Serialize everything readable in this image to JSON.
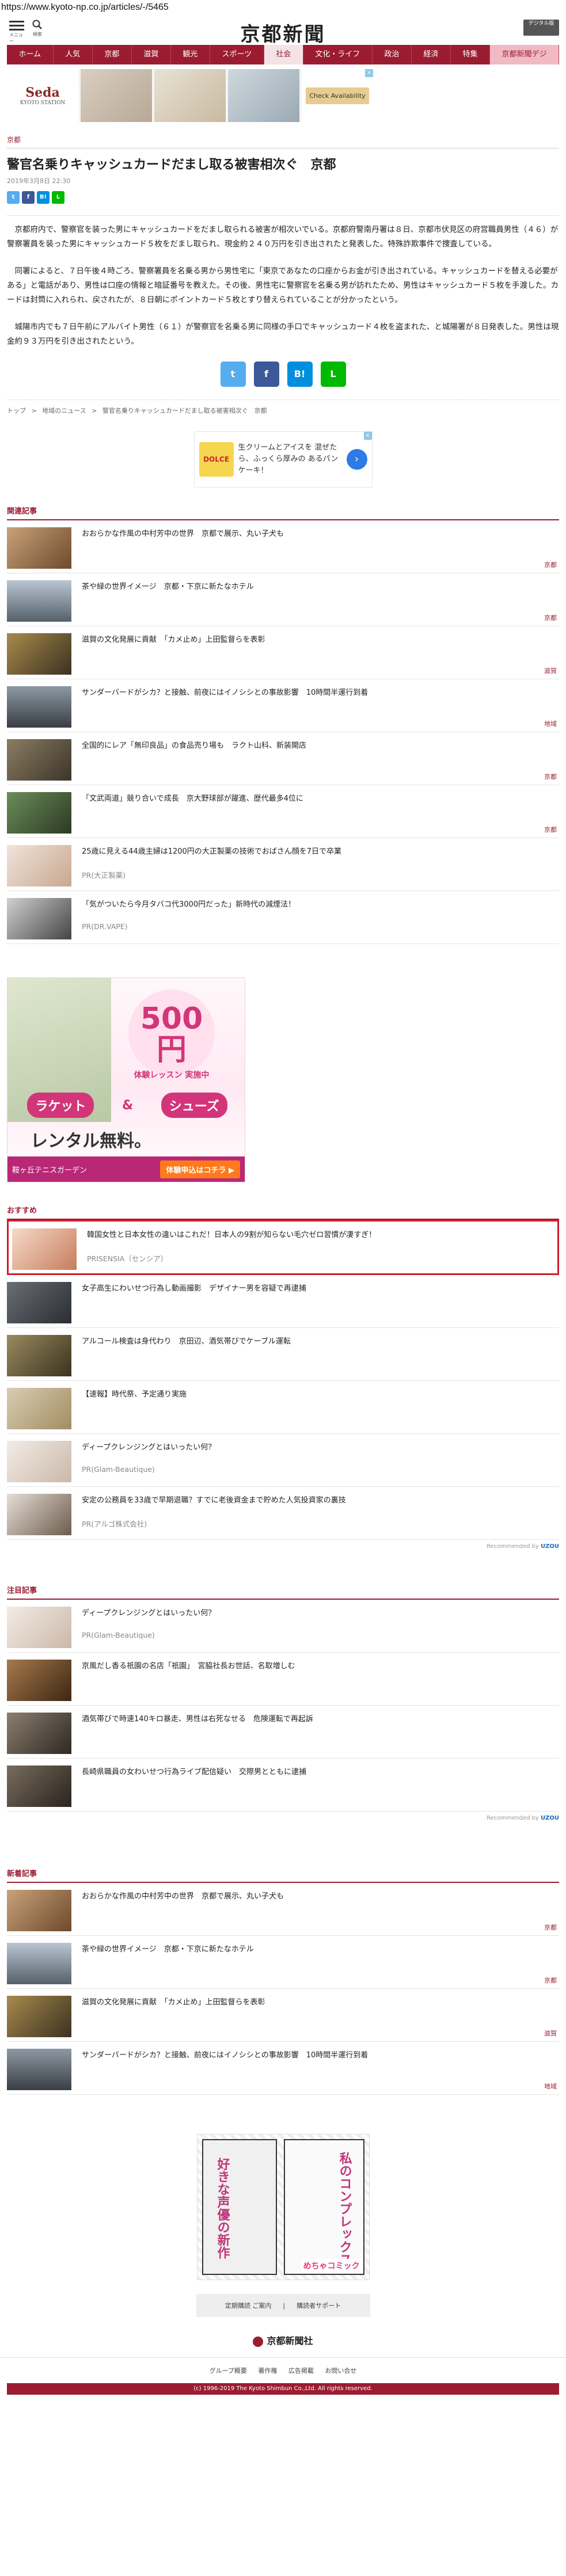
{
  "url": "https://www.kyoto-np.co.jp/articles/-/5465",
  "header": {
    "menu_label": "メニュー",
    "search_label": "検索",
    "logo": "京都新聞",
    "digital_label": "デジタル版"
  },
  "nav": [
    {
      "label": "ホーム"
    },
    {
      "label": "人気"
    },
    {
      "label": "京都"
    },
    {
      "label": "滋賀"
    },
    {
      "label": "観光"
    },
    {
      "label": "スポーツ"
    },
    {
      "label": "社会"
    },
    {
      "label": "文化・ライフ"
    },
    {
      "label": "政治"
    },
    {
      "label": "経済"
    },
    {
      "label": "特集"
    },
    {
      "label": "京都新聞デジ"
    }
  ],
  "top_ad": {
    "brand": "Seda",
    "brand_sub": "KYOTO STATION",
    "cta": "Check Availability",
    "close": "×"
  },
  "article": {
    "category": "京都",
    "title": "警官名乗りキャッシュカードだまし取る被害相次ぐ　京都",
    "date": "2019年3月8日 22:30",
    "paragraphs": [
      "京都府内で、警察官を装った男にキャッシュカードをだまし取られる被害が相次いでいる。京都府警南丹署は８日、京都市伏見区の府営職員男性（４６）が警察署員を装った男にキャッシュカード５枚をだまし取られ、現金約２４０万円を引き出されたと発表した。特殊詐欺事件で捜査している。",
      "同署によると、７日午後４時ごろ、警察署員を名乗る男から男性宅に「東京であなたの口座からお金が引き出されている。キャッシュカードを替える必要がある」と電話があり、男性は口座の情報と暗証番号を教えた。その後、男性宅に警察官を名乗る男が訪れたため、男性はキャッシュカード５枚を手渡した。カードは封筒に入れられ、戻されたが、８日朝にポイントカード５枚とすり替えられていることが分かったという。",
      "城陽市内でも７日午前にアルバイト男性（６１）が警察官を名乗る男に同様の手口でキャッシュカード４枚を盗まれた、と城陽署が８日発表した。男性は現金約９３万円を引き出されたという。"
    ],
    "share": {
      "tw": "t",
      "fb": "f",
      "hb": "B!",
      "ln": "L"
    }
  },
  "breadcrumb": [
    "トップ",
    ">",
    "地域のニュース",
    ">",
    "警官名乗りキャッシュカードだまし取る被害相次ぐ　京都"
  ],
  "mid_ad": {
    "brand": "DOLCE",
    "text": "生クリームとアイスを 混ぜたら、ふっくら厚みの あるパンケーキ！",
    "arrow": "›"
  },
  "related": {
    "heading": "関連記事",
    "items": [
      {
        "title": "おおらかな作風の中村芳中の世界　京都で展示、丸い子犬も",
        "cat": "京都"
      },
      {
        "title": "茶や緑の世界イメージ　京都・下京に新たなホテル",
        "cat": "京都"
      },
      {
        "title": "滋賀の文化発展に貢献　「カメ止め」上田監督らを表彰",
        "cat": "滋賀"
      },
      {
        "title": "サンダーバードがシカ？と接触、前夜にはイノシシとの事故影響　10時間半運行到着",
        "cat": "地域"
      },
      {
        "title": "全国的にレア「無印良品」の食品売り場も　ラクト山科、新装開店",
        "cat": "京都"
      },
      {
        "title": "「文武両道」競り合いで成長　京大野球部が躍進、歴代最多4位に",
        "cat": "京都"
      },
      {
        "title": "25歳に見える44歳主婦は1200円の大正製薬の技術でおばさん顔を7日で卒業",
        "pr": "PR(大正製薬)"
      },
      {
        "title": "「気がついたら今月タバコ代3000円だった」新時代の減煙法！",
        "pr": "PR(DR.VAPE)"
      }
    ]
  },
  "big_ad": {
    "num": "500円",
    "sub": "体験レッスン 実施中",
    "racket": "ラケット",
    "and": "&",
    "shoes": "シューズ",
    "rental": "レンタル無料。",
    "venue": "鞍ヶ丘テニスガーデン",
    "cta": "体験申込はコチラ ▶"
  },
  "recommend": {
    "heading": "おすすめ",
    "items": [
      {
        "title": "韓国女性と日本女性の違いはこれだ！日本人の9割が知らない毛穴ゼロ習慣が凄すぎ！",
        "pr": "PRISENSIA（センシア）"
      },
      {
        "title": "女子高生にわいせつ行為し動画撮影　デザイナー男を容疑で再逮捕"
      },
      {
        "title": "アルコール検査は身代わり　京田辺、酒気帯びでケーブル運転"
      },
      {
        "title": "【速報】時代祭、予定通り実施"
      },
      {
        "title": "ディープクレンジングとはいったい何？",
        "pr": "PR(Glam-Beautique)"
      },
      {
        "title": "安定の公務員を33歳で早期退職？すでに老後資金まで貯めた人気投資家の裏技",
        "pr": "PR(アルゴ株式会社)"
      }
    ],
    "by": "Recommended by",
    "by_brand": "UZOU"
  },
  "notable": {
    "heading": "注目記事",
    "items": [
      {
        "title": "ディープクレンジングとはいったい何？",
        "pr": "PR(Glam-Beautique)"
      },
      {
        "title": "京風だし香る祇園の名店「祇園」　宮脇社長お世話、名取増しむ"
      },
      {
        "title": "酒気帯びで時速140キロ暴走、男性は右死なせる　危険運転で再起訴"
      },
      {
        "title": "長崎県職員の女わいせつ行為ライブ配信疑い　交際男とともに逮捕"
      }
    ],
    "by": "Recommended by",
    "by_brand": "UZOU"
  },
  "latest": {
    "heading": "新着記事",
    "items": [
      {
        "title": "おおらかな作風の中村芳中の世界　京都で展示、丸い子犬も",
        "cat": "京都"
      },
      {
        "title": "茶や緑の世界イメージ　京都・下京に新たなホテル",
        "cat": "京都"
      },
      {
        "title": "滋賀の文化発展に貢献　「カメ止め」上田監督らを表彰",
        "cat": "滋賀"
      },
      {
        "title": "サンダーバードがシカ？と接触、前夜にはイノシシとの事故影響　10時間半運行到着",
        "cat": "地域"
      }
    ]
  },
  "bottom_ad": {
    "t1": "好きな声優の新作",
    "t2": "私のコンプレックス",
    "logo": "めちゃコミック"
  },
  "links": {
    "a": "定期購読 ご案内",
    "sep": "|",
    "b": "購読者サポート"
  },
  "footer": {
    "logo": "京都新聞社",
    "links": [
      "グループ概要",
      "著作権",
      "広告掲載",
      "お問い合せ"
    ],
    "copy": "(c) 1996-2019 The Kyoto Shimbun Co.,Ltd. All rights reserved."
  }
}
